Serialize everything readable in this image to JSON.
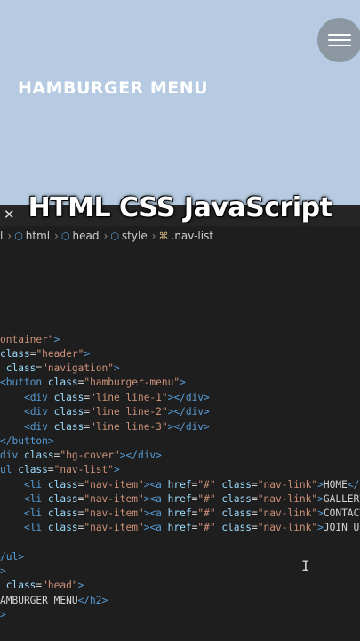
{
  "preview": {
    "title": "HAMBURGER MENU"
  },
  "caption": "HTML CSS JavaScript",
  "tab": {
    "close": "✕"
  },
  "breadcrumb": {
    "items": [
      "l",
      "html",
      "head",
      "style",
      ".nav-list"
    ],
    "sep": "›"
  },
  "code_lines": [
    [
      [
        "str",
        "ontainer\""
      ],
      [
        "tag",
        ">"
      ]
    ],
    [
      [
        "attr",
        "class"
      ],
      [
        "txt",
        "="
      ],
      [
        "str",
        "\"header\""
      ],
      [
        "tag",
        ">"
      ]
    ],
    [
      [
        "attr",
        " class"
      ],
      [
        "txt",
        "="
      ],
      [
        "str",
        "\"navigation\""
      ],
      [
        "tag",
        ">"
      ]
    ],
    [
      [
        "tag",
        "<button "
      ],
      [
        "attr",
        "class"
      ],
      [
        "txt",
        "="
      ],
      [
        "str",
        "\"hamburger-menu\""
      ],
      [
        "tag",
        ">"
      ]
    ],
    [
      [
        "txt",
        "    "
      ],
      [
        "tag",
        "<div "
      ],
      [
        "attr",
        "class"
      ],
      [
        "txt",
        "="
      ],
      [
        "str",
        "\"line line-1\""
      ],
      [
        "tag",
        "></div>"
      ]
    ],
    [
      [
        "txt",
        "    "
      ],
      [
        "tag",
        "<div "
      ],
      [
        "attr",
        "class"
      ],
      [
        "txt",
        "="
      ],
      [
        "str",
        "\"line line-2\""
      ],
      [
        "tag",
        "></div>"
      ]
    ],
    [
      [
        "txt",
        "    "
      ],
      [
        "tag",
        "<div "
      ],
      [
        "attr",
        "class"
      ],
      [
        "txt",
        "="
      ],
      [
        "str",
        "\"line line-3\""
      ],
      [
        "tag",
        "></div>"
      ]
    ],
    [
      [
        "tag",
        "</button>"
      ]
    ],
    [
      [
        "tag",
        "div "
      ],
      [
        "attr",
        "class"
      ],
      [
        "txt",
        "="
      ],
      [
        "str",
        "\"bg-cover\""
      ],
      [
        "tag",
        "></div>"
      ]
    ],
    [
      [
        "tag",
        "ul "
      ],
      [
        "attr",
        "class"
      ],
      [
        "txt",
        "="
      ],
      [
        "str",
        "\"nav-list\""
      ],
      [
        "tag",
        ">"
      ]
    ],
    [
      [
        "txt",
        "    "
      ],
      [
        "tag",
        "<li "
      ],
      [
        "attr",
        "class"
      ],
      [
        "txt",
        "="
      ],
      [
        "str",
        "\"nav-item\""
      ],
      [
        "tag",
        "><a "
      ],
      [
        "attr",
        "href"
      ],
      [
        "txt",
        "="
      ],
      [
        "str",
        "\"#\""
      ],
      [
        "attr",
        " class"
      ],
      [
        "txt",
        "="
      ],
      [
        "str",
        "\"nav-link\""
      ],
      [
        "tag",
        ">"
      ],
      [
        "txt",
        "HOME"
      ],
      [
        "tag",
        "</a>"
      ]
    ],
    [
      [
        "txt",
        "    "
      ],
      [
        "tag",
        "<li "
      ],
      [
        "attr",
        "class"
      ],
      [
        "txt",
        "="
      ],
      [
        "str",
        "\"nav-item\""
      ],
      [
        "tag",
        "><a "
      ],
      [
        "attr",
        "href"
      ],
      [
        "txt",
        "="
      ],
      [
        "str",
        "\"#\""
      ],
      [
        "attr",
        " class"
      ],
      [
        "txt",
        "="
      ],
      [
        "str",
        "\"nav-link\""
      ],
      [
        "tag",
        ">"
      ],
      [
        "txt",
        "GALLERY"
      ],
      [
        "tag",
        "<"
      ]
    ],
    [
      [
        "txt",
        "    "
      ],
      [
        "tag",
        "<li "
      ],
      [
        "attr",
        "class"
      ],
      [
        "txt",
        "="
      ],
      [
        "str",
        "\"nav-item\""
      ],
      [
        "tag",
        "><a "
      ],
      [
        "attr",
        "href"
      ],
      [
        "txt",
        "="
      ],
      [
        "str",
        "\"#\""
      ],
      [
        "attr",
        " class"
      ],
      [
        "txt",
        "="
      ],
      [
        "str",
        "\"nav-link\""
      ],
      [
        "tag",
        ">"
      ],
      [
        "txt",
        "CONTACT "
      ]
    ],
    [
      [
        "txt",
        "    "
      ],
      [
        "tag",
        "<li "
      ],
      [
        "attr",
        "class"
      ],
      [
        "txt",
        "="
      ],
      [
        "str",
        "\"nav-item\""
      ],
      [
        "tag",
        "><a "
      ],
      [
        "attr",
        "href"
      ],
      [
        "txt",
        "="
      ],
      [
        "str",
        "\"#\""
      ],
      [
        "attr",
        " class"
      ],
      [
        "txt",
        "="
      ],
      [
        "str",
        "\"nav-link\""
      ],
      [
        "tag",
        ">"
      ],
      [
        "txt",
        "JOIN US"
      ],
      [
        "tag",
        "<"
      ]
    ],
    [],
    [
      [
        "tag",
        "/ul>"
      ]
    ],
    [
      [
        "tag",
        ">"
      ]
    ],
    [
      [
        "attr",
        " class"
      ],
      [
        "txt",
        "="
      ],
      [
        "str",
        "\"head\""
      ],
      [
        "tag",
        ">"
      ]
    ],
    [
      [
        "txt",
        "AMBURGER MENU"
      ],
      [
        "tag",
        "</h2>"
      ]
    ],
    [
      [
        "tag",
        ">"
      ]
    ]
  ],
  "code_line_tops": [
    382,
    398,
    414,
    430,
    447,
    463,
    480,
    496,
    512,
    528,
    545,
    561,
    577,
    593,
    610,
    626,
    642,
    658,
    675,
    691
  ]
}
